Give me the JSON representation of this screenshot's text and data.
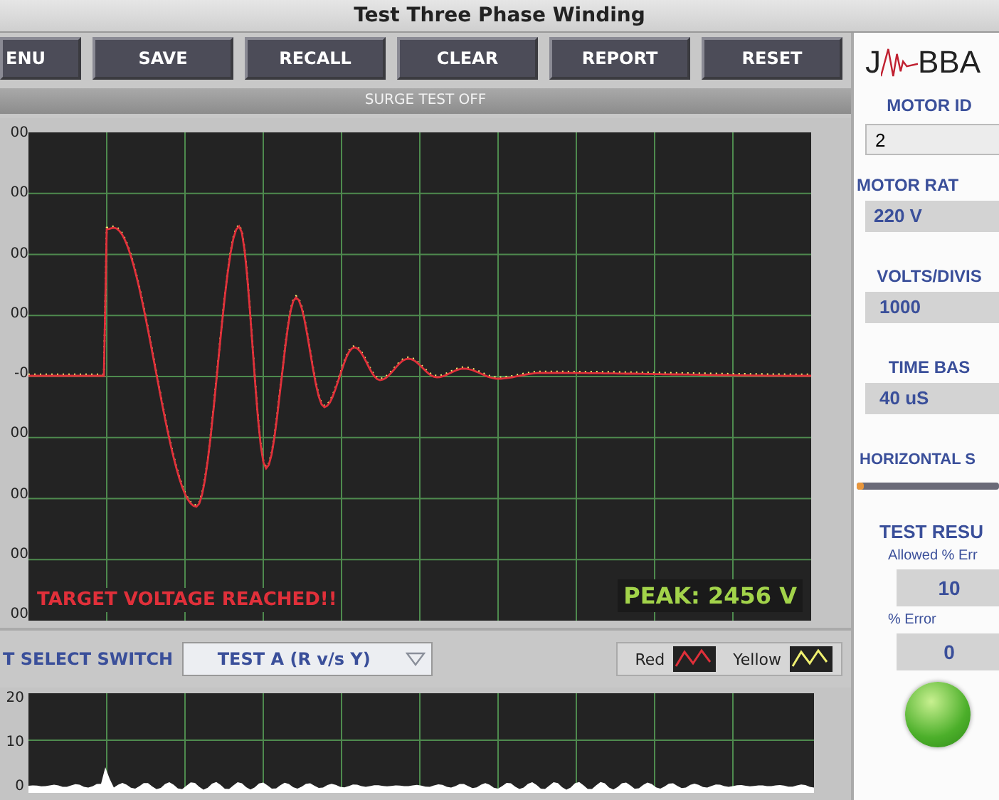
{
  "window": {
    "title": "Test Three Phase Winding"
  },
  "buttons": [
    "ENU",
    "SAVE",
    "RECALL",
    "CLEAR",
    "REPORT",
    "RESET"
  ],
  "status": "SURGE TEST OFF",
  "main_plot": {
    "y_tick_labels": [
      "00",
      "00",
      "00",
      "00",
      "-0",
      "00",
      "00",
      "00",
      "00"
    ],
    "message": "TARGET VOLTAGE REACHED!!",
    "peak": "PEAK: 2456 V"
  },
  "select": {
    "label": "T SELECT SWITCH",
    "value": "TEST A (R v/s Y)"
  },
  "legend": [
    {
      "label": "Red",
      "color": "#e0303a"
    },
    {
      "label": "Yellow",
      "color": "#f0f070"
    }
  ],
  "bottom_plot": {
    "y_tick_labels": [
      "20",
      "10",
      "0"
    ]
  },
  "side_panel": {
    "logo_left": "J",
    "logo_right": "BBA",
    "fields": [
      {
        "label": "MOTOR ID",
        "value": "2",
        "kind": "input"
      },
      {
        "label": "MOTOR RAT",
        "value": "220 V",
        "kind": "display"
      },
      {
        "label": "VOLTS/DIVIS",
        "value": "1000",
        "kind": "display"
      },
      {
        "label": "TIME BAS",
        "value": "40 uS",
        "kind": "display"
      }
    ],
    "slider": {
      "label": "HORIZONTAL S",
      "level": 0.05
    },
    "result": {
      "title": "TEST RESU",
      "allowed_label": "Allowed % Err",
      "allowed": "10",
      "error_label": "% Error",
      "error": "0",
      "led_on": true
    }
  }
}
